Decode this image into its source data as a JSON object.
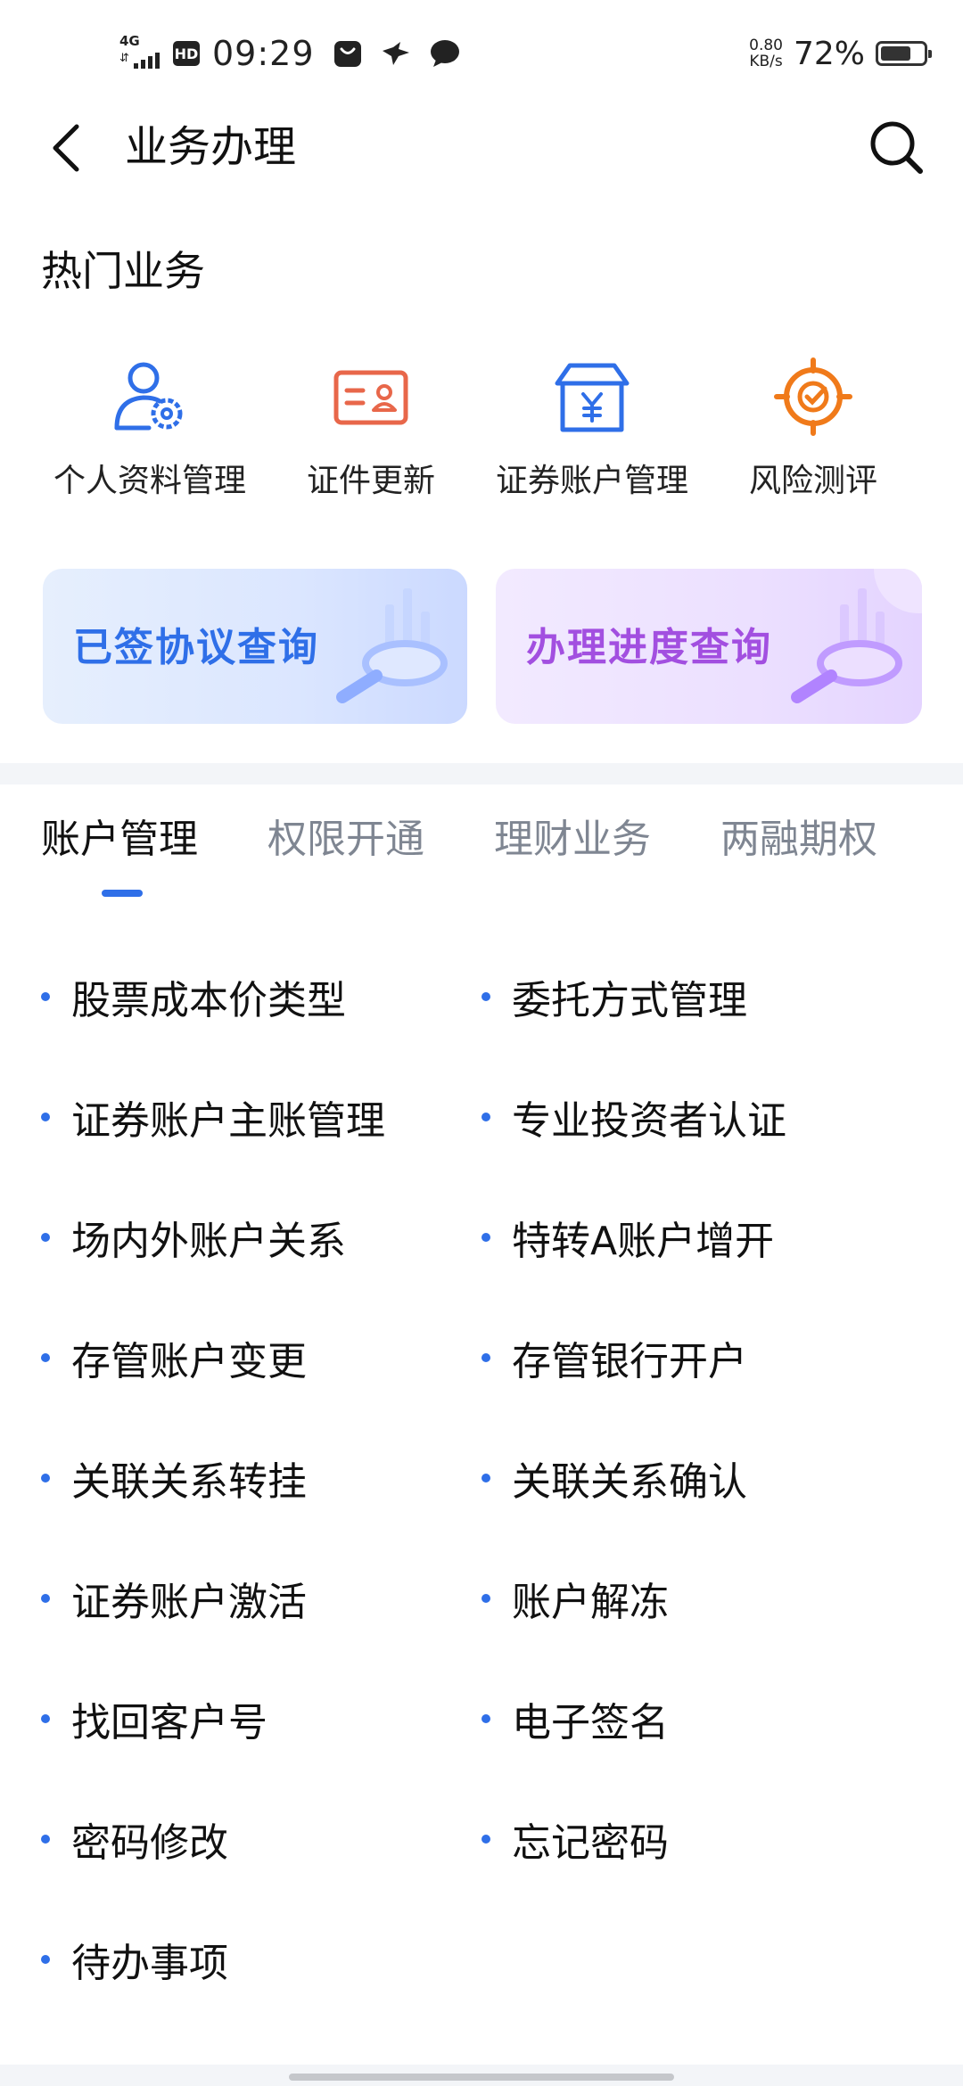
{
  "status_bar": {
    "network": "4G",
    "hd": "HD",
    "time": "09:29",
    "speed_value": "0.80",
    "speed_unit": "KB/s",
    "battery_percent": "72%",
    "battery_level": 0.72
  },
  "header": {
    "title": "业务办理"
  },
  "hot_section": {
    "title": "热门业务",
    "items": [
      {
        "label": "个人资料管理",
        "icon": "user-settings-icon"
      },
      {
        "label": "证件更新",
        "icon": "id-card-icon"
      },
      {
        "label": "证券账户管理",
        "icon": "yuan-box-icon"
      },
      {
        "label": "风险测评",
        "icon": "target-icon"
      }
    ]
  },
  "banners": [
    {
      "label": "已签协议查询",
      "icon": "magnifier-icon"
    },
    {
      "label": "办理进度查询",
      "icon": "magnifier-icon"
    }
  ],
  "tabs": [
    {
      "label": "账户管理",
      "active": true
    },
    {
      "label": "权限开通",
      "active": false
    },
    {
      "label": "理财业务",
      "active": false
    },
    {
      "label": "两融期权",
      "active": false
    }
  ],
  "list": [
    "股票成本价类型",
    "委托方式管理",
    "证券账户主账管理",
    "专业投资者认证",
    "场内外账户关系",
    "特转A账户增开",
    "存管账户变更",
    "存管银行开户",
    "关联关系转挂",
    "关联关系确认",
    "证券账户激活",
    "账户解冻",
    "找回客户号",
    "电子签名",
    "密码修改",
    "忘记密码",
    "待办事项"
  ],
  "colors": {
    "accent": "#2f6fe8",
    "purple": "#a24fe0",
    "orange": "#f07a1a",
    "idcard_red": "#e8674a"
  }
}
